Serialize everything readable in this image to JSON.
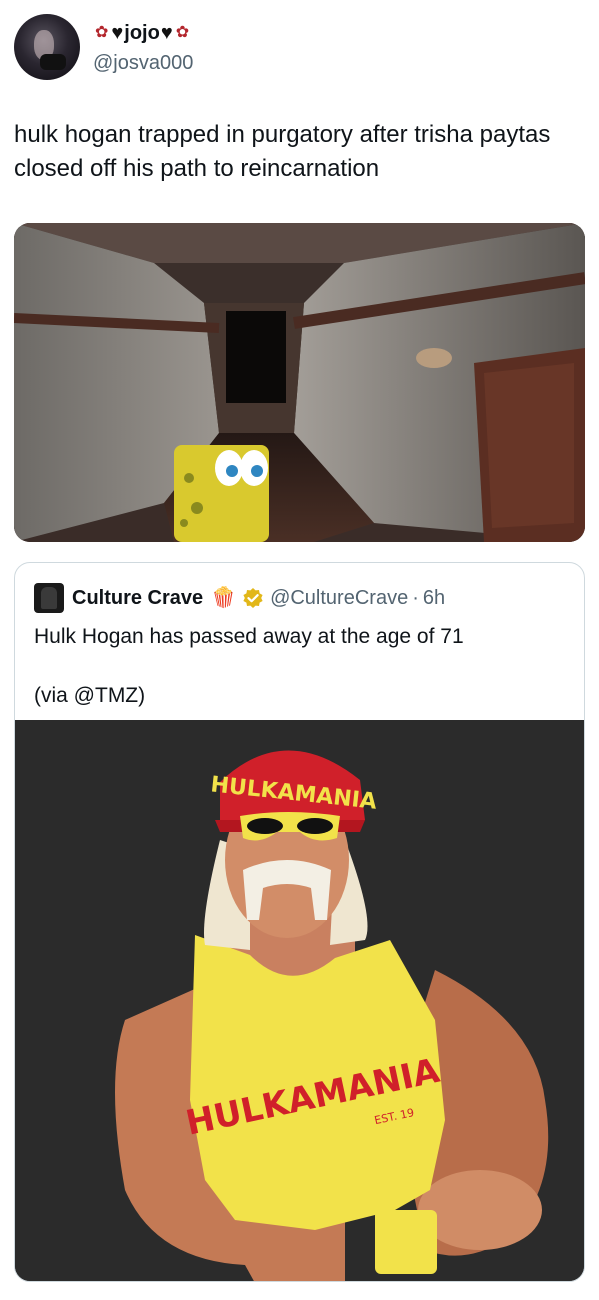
{
  "author": {
    "display_name": "jojo",
    "handle": "@josva000",
    "name_decor_icons": [
      "rose-icon",
      "black-heart-icon",
      "black-heart-icon",
      "rose-icon"
    ]
  },
  "tweet": {
    "text": "hulk hogan trapped in purgatory after trisha paytas closed off his path to reincarnation",
    "media_description_icon": "hallway-image"
  },
  "quoted_tweet": {
    "display_name": "Culture Crave",
    "name_emoji": "🍿",
    "verified": true,
    "handle": "@CultureCrave",
    "separator": "·",
    "time": "6h",
    "text": "Hulk Hogan has passed away at the age of 71",
    "via": "(via @TMZ)"
  },
  "image_text": {
    "bandana": "HULKAMANIA",
    "shirt": "HULKAMANIA",
    "shirt_small": "EST. 19"
  },
  "colors": {
    "text_primary": "#0f1419",
    "text_secondary": "#536471",
    "border": "#cfd9de",
    "verified_gold": "#e2b719",
    "bandana_red": "#d0202a",
    "shirt_yellow": "#f2e24a"
  }
}
